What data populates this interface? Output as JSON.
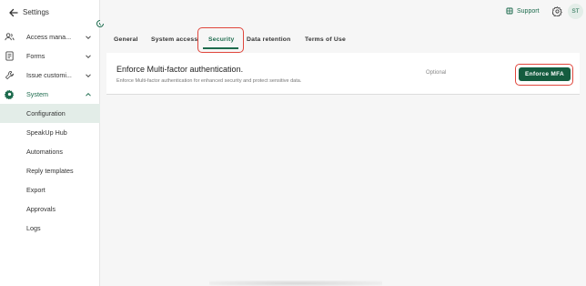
{
  "sidebar": {
    "title": "Settings",
    "items": [
      {
        "label": "Access mana...",
        "icon": "users-icon"
      },
      {
        "label": "Forms",
        "icon": "forms-icon"
      },
      {
        "label": "Issue customi...",
        "icon": "wrench-icon"
      },
      {
        "label": "System",
        "icon": "gear-icon"
      }
    ],
    "sub_items": [
      {
        "label": "Configuration"
      },
      {
        "label": "SpeakUp Hub"
      },
      {
        "label": "Automations"
      },
      {
        "label": "Reply templates"
      },
      {
        "label": "Export"
      },
      {
        "label": "Approvals"
      },
      {
        "label": "Logs"
      }
    ]
  },
  "topbar": {
    "support_label": "Support",
    "avatar_initials": "ST"
  },
  "tabs": [
    {
      "label": "General"
    },
    {
      "label": "System access"
    },
    {
      "label": "Security"
    },
    {
      "label": "Data retention"
    },
    {
      "label": "Terms of Use"
    }
  ],
  "security": {
    "title": "Enforce Multi-factor authentication.",
    "description": "Enforce Multi-factor authentication for enhanced security and protect sensitive data.",
    "status": "Optional",
    "button_label": "Enforce MFA"
  },
  "colors": {
    "brand": "#1d6b4d",
    "button": "#145c3f",
    "highlight": "#e0463c",
    "selected_bg": "#e3ede8"
  }
}
